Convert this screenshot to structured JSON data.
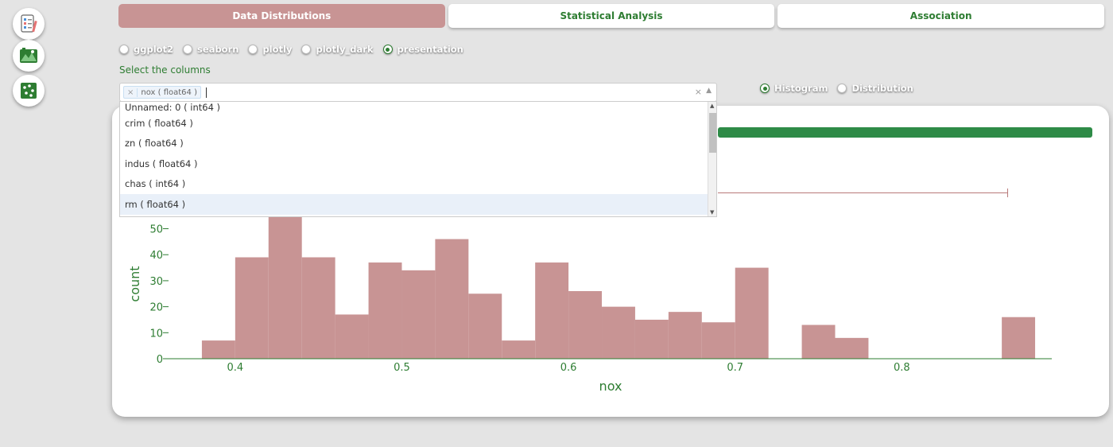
{
  "sidebar": {
    "items": [
      {
        "icon": "checklist-icon"
      },
      {
        "icon": "landscape-chart-icon"
      },
      {
        "icon": "scatter-grid-icon"
      }
    ]
  },
  "tabs": [
    {
      "label": "Data Distributions",
      "active": true
    },
    {
      "label": "Statistical Analysis",
      "active": false
    },
    {
      "label": "Association",
      "active": false
    }
  ],
  "themes": {
    "options": [
      "ggplot2",
      "seaborn",
      "plotly",
      "plotly_dark",
      "presentation"
    ],
    "selected": "presentation"
  },
  "column_select": {
    "label": "Select the columns",
    "selected_tag": "nox ( float64 )",
    "remove_symbol": "×",
    "clear_symbol": "×",
    "toggle_symbol": "▲",
    "options": [
      "Unnamed: 0 ( int64 )",
      "crim ( float64 )",
      "zn ( float64 )",
      "indus ( float64 )",
      "chas ( int64 )",
      "rm ( float64 )"
    ],
    "highlighted": "rm ( float64 )"
  },
  "plot_type": {
    "options": [
      "Histogram",
      "Distribution"
    ],
    "selected": "Histogram"
  },
  "colors": {
    "accent": "#2e7d32",
    "bar": "#c89494",
    "active_tab": "#c89494"
  },
  "chart_data": {
    "type": "bar",
    "xlabel": "nox",
    "ylabel": "count",
    "xlim": [
      0.36,
      0.89
    ],
    "ylim": [
      0,
      52
    ],
    "x_ticks": [
      0.4,
      0.5,
      0.6,
      0.7,
      0.8
    ],
    "y_ticks": [
      0,
      10,
      20,
      30,
      40,
      50
    ],
    "bin_width": 0.02,
    "bins": [
      {
        "x0": 0.38,
        "count": 7
      },
      {
        "x0": 0.4,
        "count": 39
      },
      {
        "x0": 0.42,
        "count": 55
      },
      {
        "x0": 0.44,
        "count": 39
      },
      {
        "x0": 0.46,
        "count": 17
      },
      {
        "x0": 0.48,
        "count": 37
      },
      {
        "x0": 0.5,
        "count": 34
      },
      {
        "x0": 0.52,
        "count": 46
      },
      {
        "x0": 0.54,
        "count": 25
      },
      {
        "x0": 0.56,
        "count": 7
      },
      {
        "x0": 0.58,
        "count": 37
      },
      {
        "x0": 0.6,
        "count": 26
      },
      {
        "x0": 0.62,
        "count": 20
      },
      {
        "x0": 0.64,
        "count": 15
      },
      {
        "x0": 0.66,
        "count": 18
      },
      {
        "x0": 0.68,
        "count": 14
      },
      {
        "x0": 0.7,
        "count": 35
      },
      {
        "x0": 0.72,
        "count": 0
      },
      {
        "x0": 0.74,
        "count": 13
      },
      {
        "x0": 0.76,
        "count": 8
      },
      {
        "x0": 0.78,
        "count": 0
      },
      {
        "x0": 0.8,
        "count": 0
      },
      {
        "x0": 0.82,
        "count": 0
      },
      {
        "x0": 0.84,
        "count": 0
      },
      {
        "x0": 0.86,
        "count": 16
      }
    ],
    "grid": false
  }
}
